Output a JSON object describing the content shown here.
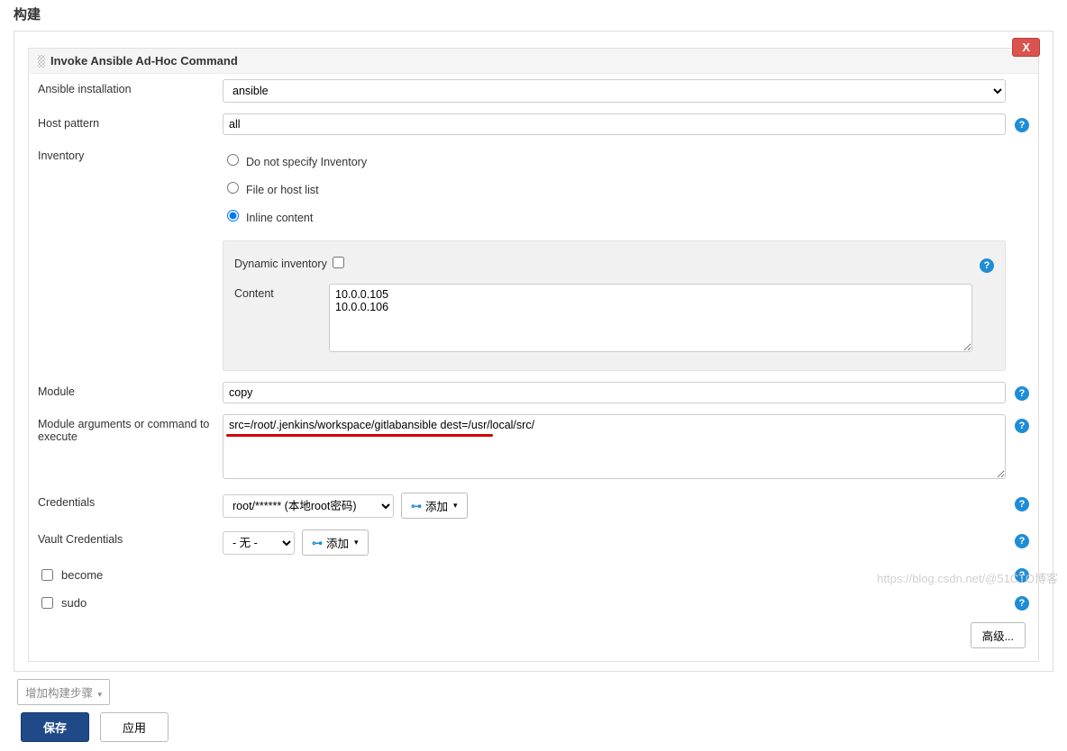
{
  "section_title": "构建",
  "step_header": "Invoke Ansible Ad-Hoc Command",
  "close_label": "X",
  "labels": {
    "ansible_installation": "Ansible installation",
    "host_pattern": "Host pattern",
    "inventory": "Inventory",
    "dynamic_inventory": "Dynamic inventory",
    "content": "Content",
    "module": "Module",
    "module_args": "Module arguments or command to execute",
    "credentials": "Credentials",
    "vault_credentials": "Vault Credentials",
    "become": "become",
    "sudo": "sudo"
  },
  "values": {
    "ansible_installation": "ansible",
    "host_pattern": "all",
    "inventory_radio": {
      "do_not_specify": "Do not specify Inventory",
      "file_or_host": "File or host list",
      "inline_content": "Inline content"
    },
    "content_text": "10.0.0.105\n10.0.0.106",
    "module": "copy",
    "module_args_text": "src=/root/.jenkins/workspace/gitlabansible dest=/usr/local/src/",
    "credentials_selected": "root/****** (本地root密码)",
    "vault_selected": "- 无 -"
  },
  "buttons": {
    "add": "添加",
    "advanced": "高级...",
    "add_step": "增加构建步骤",
    "save": "保存",
    "apply": "应用"
  },
  "watermark": "https://blog.csdn.net/@51CTO博客"
}
